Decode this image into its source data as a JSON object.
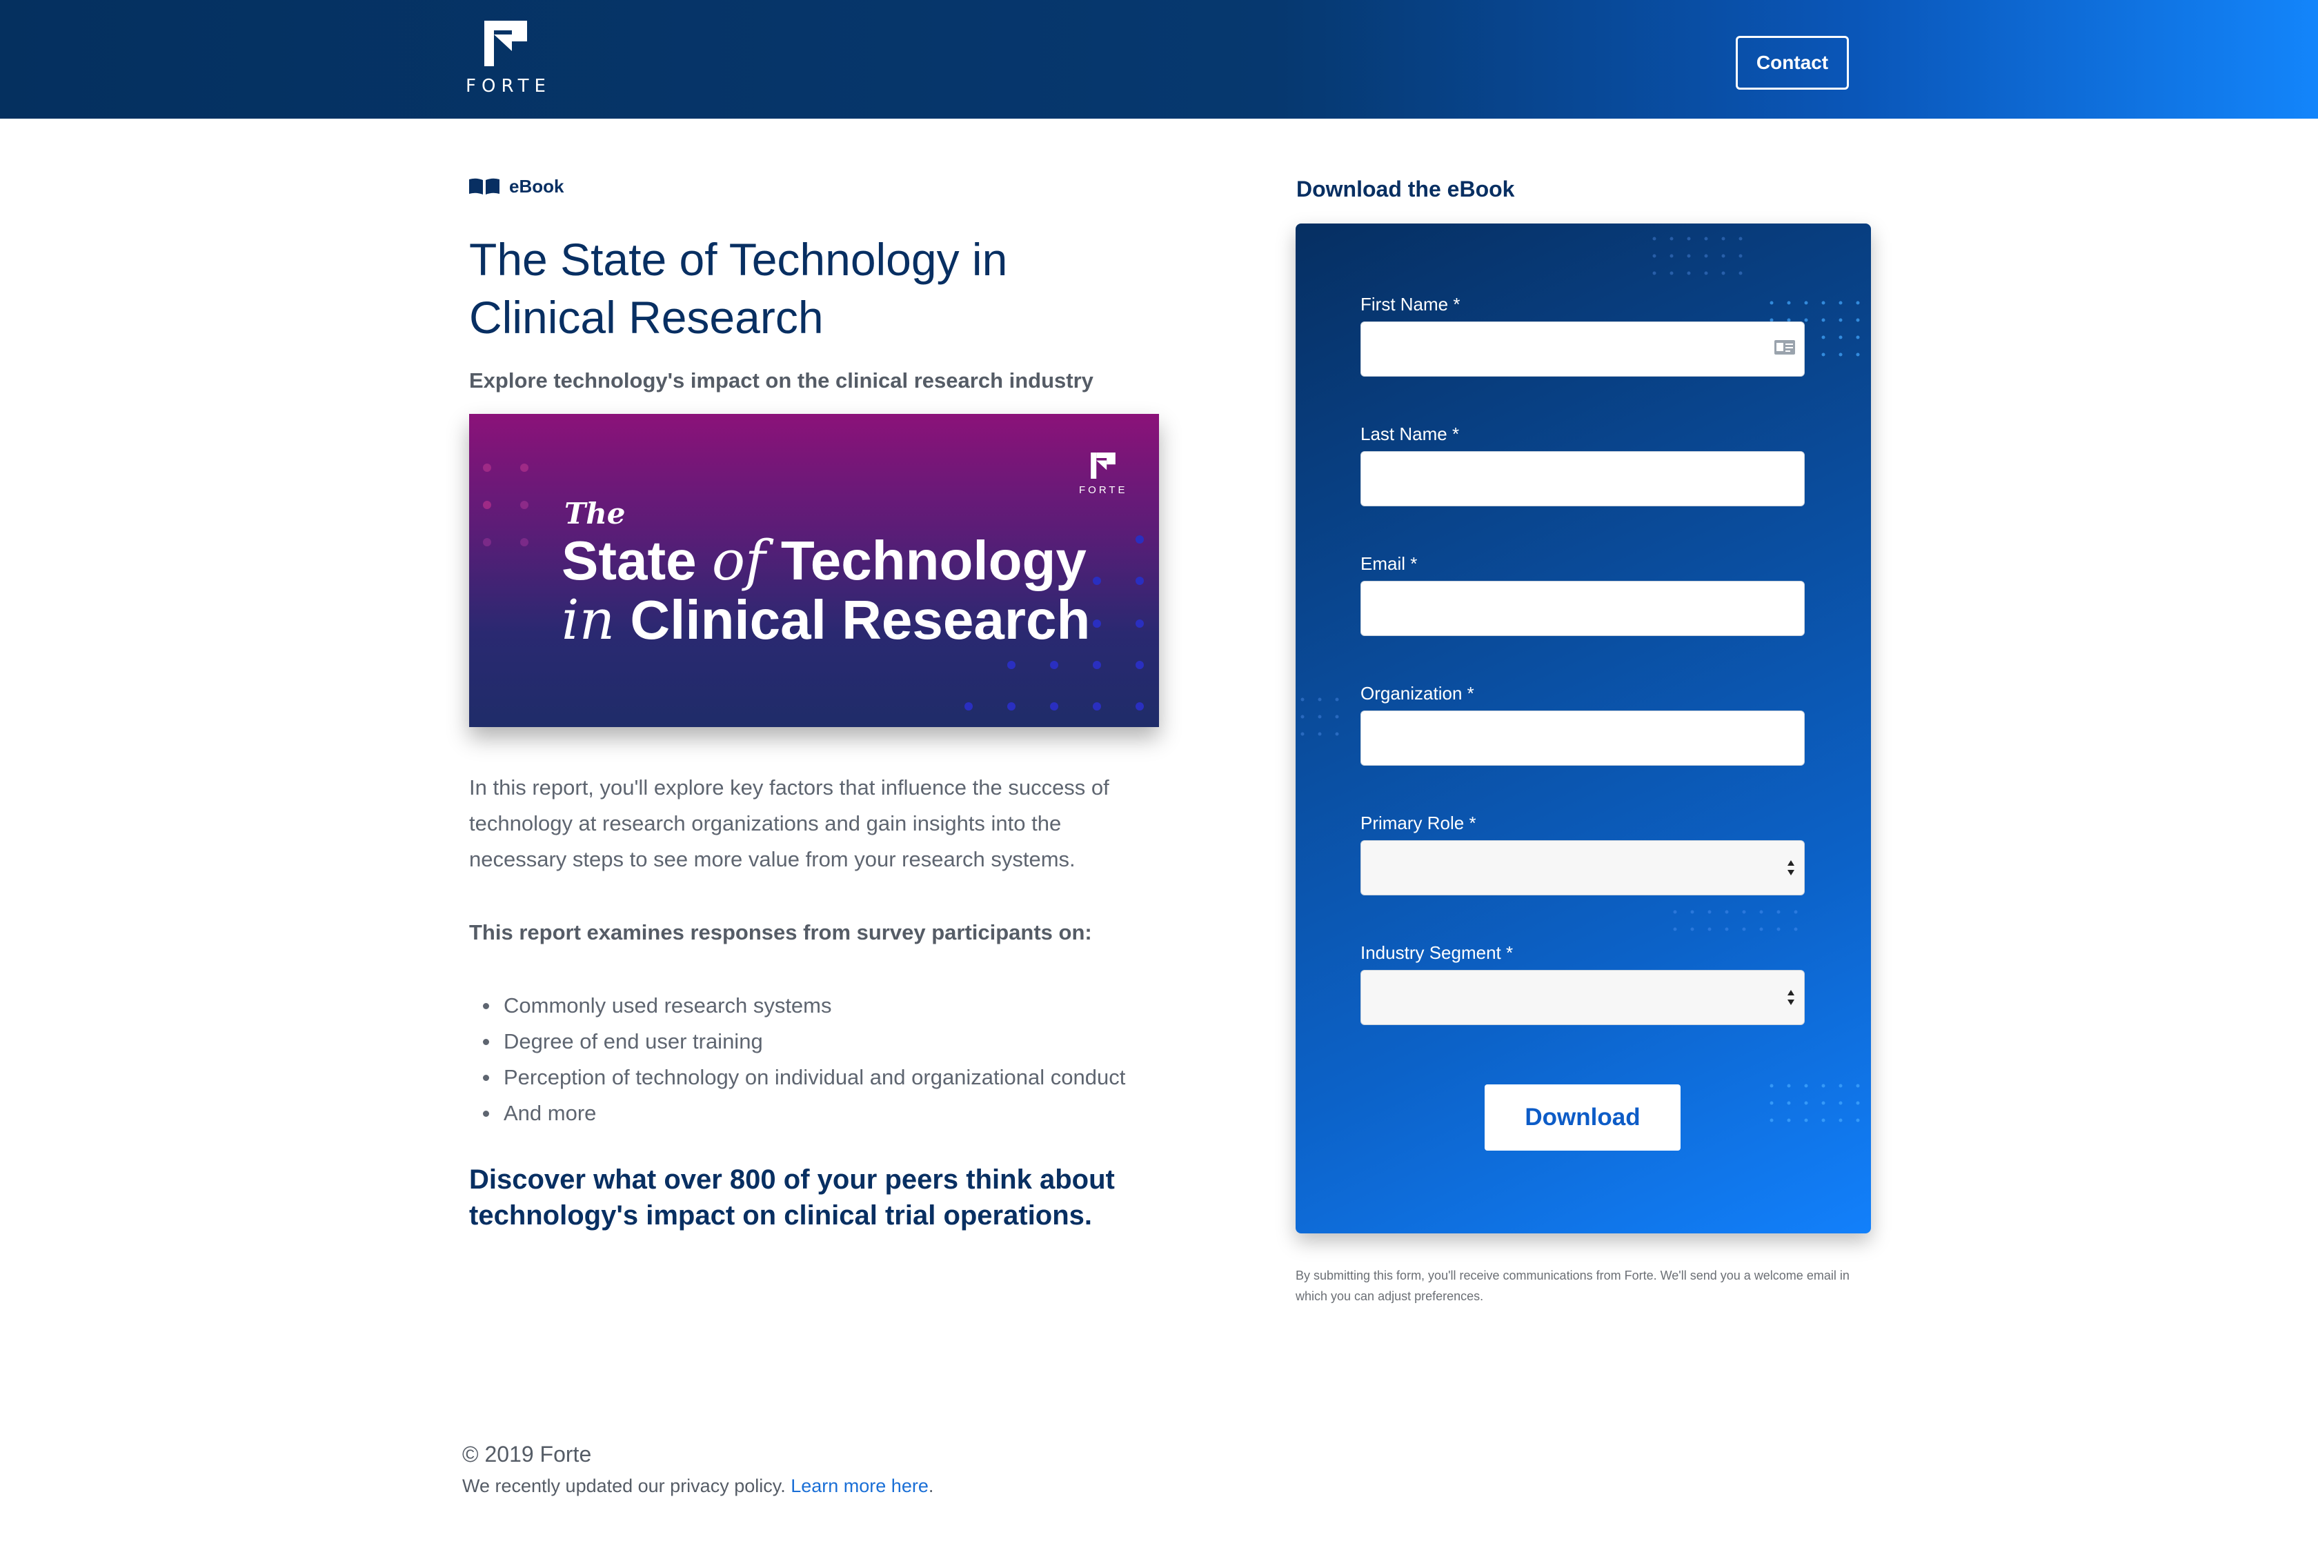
{
  "header": {
    "logo_text": "FORTE",
    "contact_label": "Contact"
  },
  "content": {
    "tag_label": "eBook",
    "title": "The State of Technology in Clinical Research",
    "subtitle": "Explore technology's impact on the clinical research industry",
    "cover": {
      "logo_text": "FORTE",
      "the": "The",
      "line1_a": "State ",
      "line1_of": "of",
      "line1_b": " Technology",
      "line2_in": "in",
      "line2_b": " Clinical Research"
    },
    "intro": "In this report, you'll explore key factors that influence the success of technology at research organizations and gain insights into the necessary steps to see more value from your research systems.",
    "examines": "This report examines responses from survey participants on:",
    "bullets": [
      "Commonly used research systems",
      "Degree of end user training",
      "Perception of technology on individual and organizational conduct",
      "And more"
    ],
    "discover": "Discover what over 800 of your peers think about technology's impact on clinical trial operations."
  },
  "form": {
    "heading": "Download the eBook",
    "fields": [
      {
        "label": "First Name *",
        "value": ""
      },
      {
        "label": "Last Name *",
        "value": ""
      },
      {
        "label": "Email *",
        "value": ""
      },
      {
        "label": "Organization *",
        "value": ""
      },
      {
        "label": "Primary Role *",
        "value": ""
      },
      {
        "label": "Industry Segment *",
        "value": ""
      }
    ],
    "submit_label": "Download",
    "disclaimer": "By submitting this form, you'll receive communications from Forte. We'll send you a welcome email in which you can adjust preferences."
  },
  "footer": {
    "copyright": "© 2019 Forte",
    "privacy_text": "We recently updated our privacy policy. ",
    "privacy_link": "Learn more here",
    "privacy_end": "."
  },
  "colors": {
    "navy": "#082f62",
    "header_start": "#05305f",
    "header_end": "#1385fb",
    "link": "#1a6fd6"
  }
}
